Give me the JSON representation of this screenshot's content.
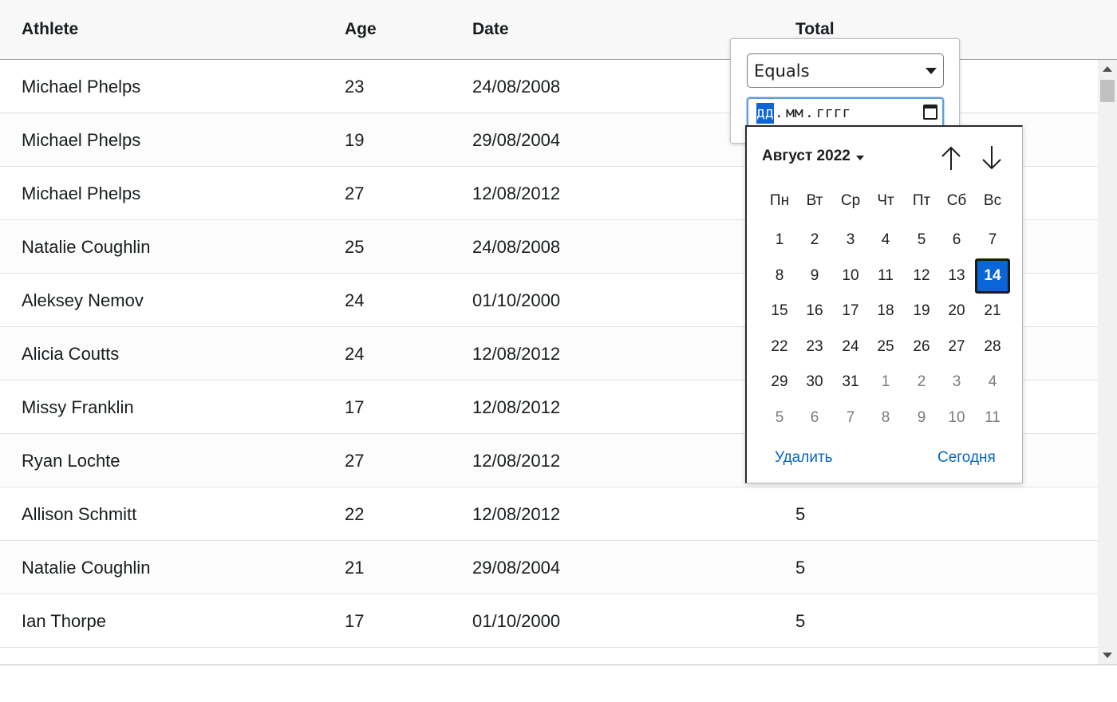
{
  "grid": {
    "columns": [
      "Athlete",
      "Age",
      "Date",
      "Total"
    ],
    "rows": [
      {
        "athlete": "Michael Phelps",
        "age": "23",
        "date": "24/08/2008",
        "total": ""
      },
      {
        "athlete": "Michael Phelps",
        "age": "19",
        "date": "29/08/2004",
        "total": ""
      },
      {
        "athlete": "Michael Phelps",
        "age": "27",
        "date": "12/08/2012",
        "total": ""
      },
      {
        "athlete": "Natalie Coughlin",
        "age": "25",
        "date": "24/08/2008",
        "total": ""
      },
      {
        "athlete": "Aleksey Nemov",
        "age": "24",
        "date": "01/10/2000",
        "total": ""
      },
      {
        "athlete": "Alicia Coutts",
        "age": "24",
        "date": "12/08/2012",
        "total": ""
      },
      {
        "athlete": "Missy Franklin",
        "age": "17",
        "date": "12/08/2012",
        "total": ""
      },
      {
        "athlete": "Ryan Lochte",
        "age": "27",
        "date": "12/08/2012",
        "total": ""
      },
      {
        "athlete": "Allison Schmitt",
        "age": "22",
        "date": "12/08/2012",
        "total": "5"
      },
      {
        "athlete": "Natalie Coughlin",
        "age": "21",
        "date": "29/08/2004",
        "total": "5"
      },
      {
        "athlete": "Ian Thorpe",
        "age": "17",
        "date": "01/10/2000",
        "total": "5"
      }
    ]
  },
  "filter": {
    "operator": "Equals",
    "date_input": {
      "day": "дд",
      "sep1": ".",
      "month": "мм",
      "sep2": ".",
      "year": "гггг"
    }
  },
  "calendar": {
    "month_label": "Август 2022",
    "weekdays": [
      "Пн",
      "Вт",
      "Ср",
      "Чт",
      "Пт",
      "Сб",
      "Вс"
    ],
    "weeks": [
      [
        "1",
        "2",
        "3",
        "4",
        "5",
        "6",
        "7"
      ],
      [
        "8",
        "9",
        "10",
        "11",
        "12",
        "13",
        "14"
      ],
      [
        "15",
        "16",
        "17",
        "18",
        "19",
        "20",
        "21"
      ],
      [
        "22",
        "23",
        "24",
        "25",
        "26",
        "27",
        "28"
      ],
      [
        "29",
        "30",
        "31",
        "1",
        "2",
        "3",
        "4"
      ],
      [
        "5",
        "6",
        "7",
        "8",
        "9",
        "10",
        "11"
      ]
    ],
    "selected_day": "14",
    "clear_label": "Удалить",
    "today_label": "Сегодня"
  },
  "colors": {
    "accent": "#0a66d6",
    "link": "#0a66c2",
    "focus_ring": "#5b9dd9"
  }
}
